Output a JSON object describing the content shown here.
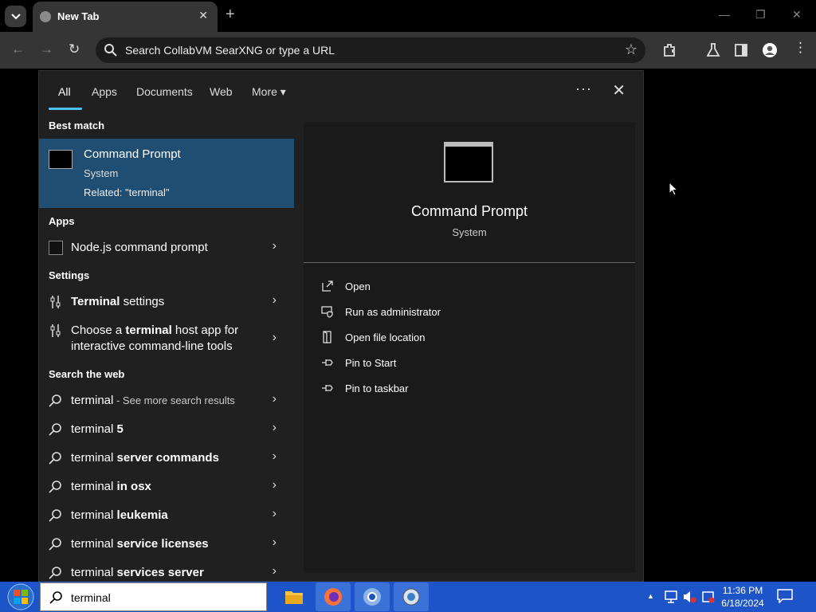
{
  "browser": {
    "tab_title": "New Tab",
    "tab_close": "✕",
    "new_tab": "+",
    "address_text": "Search CollabVM SearXNG or type a URL",
    "window_controls": {
      "minimize": "—",
      "restore": "❐",
      "close": "✕"
    }
  },
  "flyout": {
    "tabs": [
      "All",
      "Apps",
      "Documents",
      "Web",
      "More"
    ],
    "more_caret": "▾",
    "dots": "···",
    "close": "✕",
    "best_match_heading": "Best match",
    "best_match": {
      "name": "Command Prompt",
      "sub": "System",
      "related": "Related: \"terminal\""
    },
    "apps_heading": "Apps",
    "apps": [
      {
        "label": "Node.js command prompt"
      }
    ],
    "settings_heading": "Settings",
    "settings": [
      {
        "bold": "Terminal",
        "rest": " settings"
      },
      {
        "pre": "Choose a ",
        "bold": "terminal",
        "rest": " host app for interactive command-line tools"
      }
    ],
    "web_heading": "Search the web",
    "web": [
      {
        "pre": "terminal",
        "small": " - See more search results"
      },
      {
        "pre": "terminal ",
        "bold": "5"
      },
      {
        "pre": "terminal ",
        "bold": "server commands"
      },
      {
        "pre": "terminal ",
        "bold": "in osx"
      },
      {
        "pre": "terminal ",
        "bold": "leukemia"
      },
      {
        "pre": "terminal ",
        "bold": "service licenses"
      },
      {
        "pre": "terminal ",
        "bold": "services server"
      }
    ],
    "chevron": "›",
    "detail": {
      "name": "Command Prompt",
      "sub": "System",
      "actions": [
        "Open",
        "Run as administrator",
        "Open file location",
        "Pin to Start",
        "Pin to taskbar"
      ]
    }
  },
  "taskbar": {
    "search_text": "terminal",
    "clock_time": "11:36 PM",
    "clock_date": "6/18/2024",
    "tray_up": "▲"
  }
}
